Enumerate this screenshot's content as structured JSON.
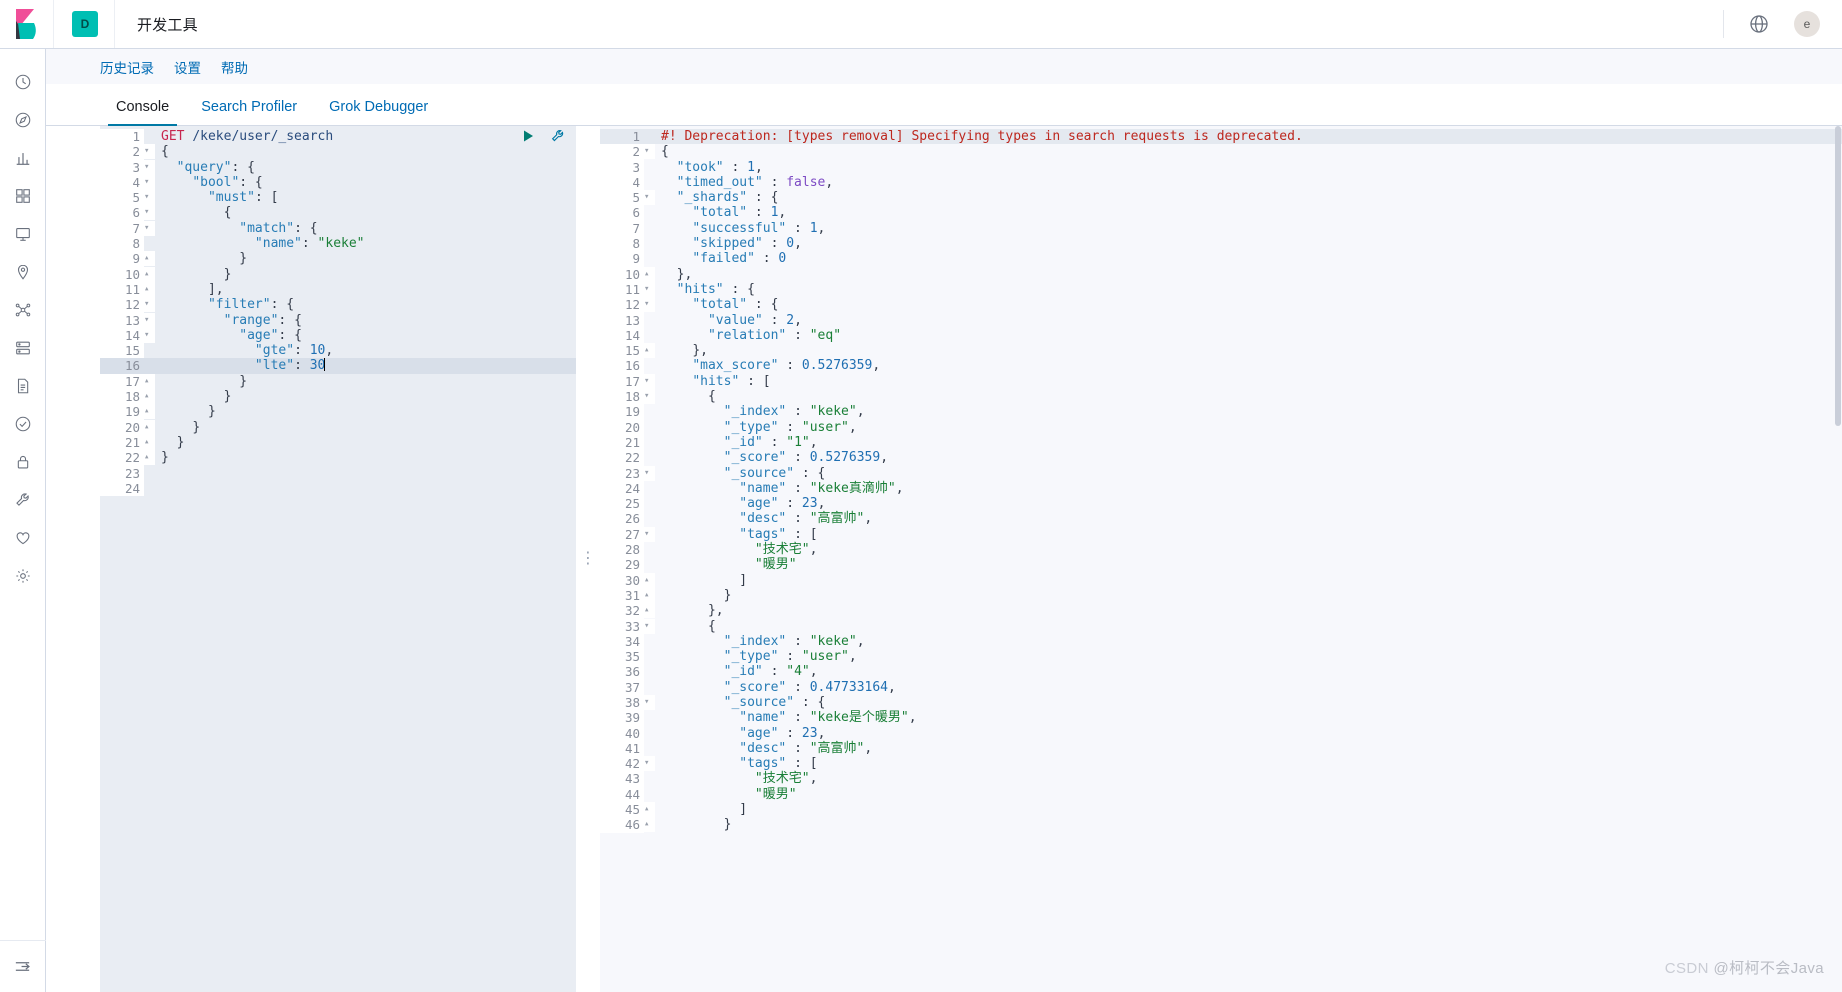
{
  "header": {
    "logo_name": "kibana-logo",
    "space_badge": "D",
    "title": "开发工具",
    "help_icon": "help-circle-icon",
    "avatar_initial": "e"
  },
  "rail": {
    "items": [
      {
        "icon": "recently-viewed-clock-icon",
        "name": "sidebar-item-recent"
      },
      {
        "icon": "compass-discover-icon",
        "name": "sidebar-item-discover"
      },
      {
        "icon": "bar-chart-visualize-icon",
        "name": "sidebar-item-visualize"
      },
      {
        "icon": "dashboard-grid-icon",
        "name": "sidebar-item-dashboard"
      },
      {
        "icon": "canvas-icon",
        "name": "sidebar-item-canvas"
      },
      {
        "icon": "maps-pin-icon",
        "name": "sidebar-item-maps"
      },
      {
        "icon": "machine-learning-icon",
        "name": "sidebar-item-machine-learning"
      },
      {
        "icon": "infrastructure-icon",
        "name": "sidebar-item-infrastructure"
      },
      {
        "icon": "logs-document-icon",
        "name": "sidebar-item-logs"
      },
      {
        "icon": "uptime-check-icon",
        "name": "sidebar-item-uptime"
      },
      {
        "icon": "security-lock-icon",
        "name": "sidebar-item-security"
      },
      {
        "icon": "dev-tools-wrench-icon",
        "name": "sidebar-item-dev-tools"
      },
      {
        "icon": "monitoring-heart-icon",
        "name": "sidebar-item-monitoring"
      },
      {
        "icon": "management-gear-icon",
        "name": "sidebar-item-management"
      }
    ],
    "collapse_icon": "collapse-arrow-icon"
  },
  "subnav": {
    "items": [
      {
        "label": "历史记录",
        "name": "subnav-history"
      },
      {
        "label": "设置",
        "name": "subnav-settings"
      },
      {
        "label": "帮助",
        "name": "subnav-help"
      }
    ]
  },
  "tabs": [
    {
      "label": "Console",
      "active": true,
      "name": "tab-console"
    },
    {
      "label": "Search Profiler",
      "active": false,
      "name": "tab-search-profiler"
    },
    {
      "label": "Grok Debugger",
      "active": false,
      "name": "tab-grok-debugger"
    }
  ],
  "editor_actions": {
    "run_icon": "play-triangle-icon",
    "wrench_icon": "wrench-icon"
  },
  "request_editor": {
    "highlighted_line": 16,
    "caret_line": 16,
    "lines": [
      {
        "n": 1,
        "fold": "",
        "html": "<span class='t-method'>GET</span> <span class='t-url'>/keke/user/_search</span>"
      },
      {
        "n": 2,
        "fold": "▾",
        "html": "<span class='t-punct'>{</span>"
      },
      {
        "n": 3,
        "fold": "▾",
        "html": "  <span class='t-key'>\"query\"</span><span class='t-punct'>: {</span>"
      },
      {
        "n": 4,
        "fold": "▾",
        "html": "    <span class='t-key'>\"bool\"</span><span class='t-punct'>: {</span>"
      },
      {
        "n": 5,
        "fold": "▾",
        "html": "      <span class='t-key'>\"must\"</span><span class='t-punct'>: [</span>"
      },
      {
        "n": 6,
        "fold": "▾",
        "html": "        <span class='t-punct'>{</span>"
      },
      {
        "n": 7,
        "fold": "▾",
        "html": "          <span class='t-key'>\"match\"</span><span class='t-punct'>: {</span>"
      },
      {
        "n": 8,
        "fold": "",
        "html": "            <span class='t-key'>\"name\"</span><span class='t-punct'>: </span><span class='t-str'>\"keke\"</span>"
      },
      {
        "n": 9,
        "fold": "▴",
        "html": "          <span class='t-punct'>}</span>"
      },
      {
        "n": 10,
        "fold": "▴",
        "html": "        <span class='t-punct'>}</span>"
      },
      {
        "n": 11,
        "fold": "▴",
        "html": "      <span class='t-punct'>],</span>"
      },
      {
        "n": 12,
        "fold": "▾",
        "html": "      <span class='t-key'>\"filter\"</span><span class='t-punct'>: {</span>"
      },
      {
        "n": 13,
        "fold": "▾",
        "html": "        <span class='t-key'>\"range\"</span><span class='t-punct'>: {</span>"
      },
      {
        "n": 14,
        "fold": "▾",
        "html": "          <span class='t-key'>\"age\"</span><span class='t-punct'>: {</span>"
      },
      {
        "n": 15,
        "fold": "",
        "html": "            <span class='t-key'>\"gte\"</span><span class='t-punct'>: </span><span class='t-num'>10</span><span class='t-punct'>,</span>"
      },
      {
        "n": 16,
        "fold": "",
        "html": "            <span class='t-key'>\"lte\"</span><span class='t-punct'>: </span><span class='t-num'>30</span><span class='caret'></span>"
      },
      {
        "n": 17,
        "fold": "▴",
        "html": "          <span class='t-punct'>}</span>"
      },
      {
        "n": 18,
        "fold": "▴",
        "html": "        <span class='t-punct'>}</span>"
      },
      {
        "n": 19,
        "fold": "▴",
        "html": "      <span class='t-punct'>}</span>"
      },
      {
        "n": 20,
        "fold": "▴",
        "html": "    <span class='t-punct'>}</span>"
      },
      {
        "n": 21,
        "fold": "▴",
        "html": "  <span class='t-punct'>}</span>"
      },
      {
        "n": 22,
        "fold": "▴",
        "html": "<span class='t-punct'>}</span>"
      },
      {
        "n": 23,
        "fold": "",
        "html": ""
      },
      {
        "n": 24,
        "fold": "",
        "html": ""
      }
    ]
  },
  "response_editor": {
    "highlighted_line": 1,
    "lines": [
      {
        "n": 1,
        "fold": "",
        "html": "<span class='t-warn'>#! Deprecation: [types removal] Specifying types in search requests is deprecated.</span>"
      },
      {
        "n": 2,
        "fold": "▾",
        "html": "<span class='t-punct'>{</span>"
      },
      {
        "n": 3,
        "fold": "",
        "html": "  <span class='t-key'>\"took\"</span><span class='t-punct'> : </span><span class='t-num'>1</span><span class='t-punct'>,</span>"
      },
      {
        "n": 4,
        "fold": "",
        "html": "  <span class='t-key'>\"timed_out\"</span><span class='t-punct'> : </span><span class='t-bool'>false</span><span class='t-punct'>,</span>"
      },
      {
        "n": 5,
        "fold": "▾",
        "html": "  <span class='t-key'>\"_shards\"</span><span class='t-punct'> : {</span>"
      },
      {
        "n": 6,
        "fold": "",
        "html": "    <span class='t-key'>\"total\"</span><span class='t-punct'> : </span><span class='t-num'>1</span><span class='t-punct'>,</span>"
      },
      {
        "n": 7,
        "fold": "",
        "html": "    <span class='t-key'>\"successful\"</span><span class='t-punct'> : </span><span class='t-num'>1</span><span class='t-punct'>,</span>"
      },
      {
        "n": 8,
        "fold": "",
        "html": "    <span class='t-key'>\"skipped\"</span><span class='t-punct'> : </span><span class='t-num'>0</span><span class='t-punct'>,</span>"
      },
      {
        "n": 9,
        "fold": "",
        "html": "    <span class='t-key'>\"failed\"</span><span class='t-punct'> : </span><span class='t-num'>0</span>"
      },
      {
        "n": 10,
        "fold": "▴",
        "html": "  <span class='t-punct'>},</span>"
      },
      {
        "n": 11,
        "fold": "▾",
        "html": "  <span class='t-key'>\"hits\"</span><span class='t-punct'> : {</span>"
      },
      {
        "n": 12,
        "fold": "▾",
        "html": "    <span class='t-key'>\"total\"</span><span class='t-punct'> : {</span>"
      },
      {
        "n": 13,
        "fold": "",
        "html": "      <span class='t-key'>\"value\"</span><span class='t-punct'> : </span><span class='t-num'>2</span><span class='t-punct'>,</span>"
      },
      {
        "n": 14,
        "fold": "",
        "html": "      <span class='t-key'>\"relation\"</span><span class='t-punct'> : </span><span class='t-str'>\"eq\"</span>"
      },
      {
        "n": 15,
        "fold": "▴",
        "html": "    <span class='t-punct'>},</span>"
      },
      {
        "n": 16,
        "fold": "",
        "html": "    <span class='t-key'>\"max_score\"</span><span class='t-punct'> : </span><span class='t-num'>0.5276359</span><span class='t-punct'>,</span>"
      },
      {
        "n": 17,
        "fold": "▾",
        "html": "    <span class='t-key'>\"hits\"</span><span class='t-punct'> : [</span>"
      },
      {
        "n": 18,
        "fold": "▾",
        "html": "      <span class='t-punct'>{</span>"
      },
      {
        "n": 19,
        "fold": "",
        "html": "        <span class='t-key'>\"_index\"</span><span class='t-punct'> : </span><span class='t-str'>\"keke\"</span><span class='t-punct'>,</span>"
      },
      {
        "n": 20,
        "fold": "",
        "html": "        <span class='t-key'>\"_type\"</span><span class='t-punct'> : </span><span class='t-str'>\"user\"</span><span class='t-punct'>,</span>"
      },
      {
        "n": 21,
        "fold": "",
        "html": "        <span class='t-key'>\"_id\"</span><span class='t-punct'> : </span><span class='t-str'>\"1\"</span><span class='t-punct'>,</span>"
      },
      {
        "n": 22,
        "fold": "",
        "html": "        <span class='t-key'>\"_score\"</span><span class='t-punct'> : </span><span class='t-num'>0.5276359</span><span class='t-punct'>,</span>"
      },
      {
        "n": 23,
        "fold": "▾",
        "html": "        <span class='t-key'>\"_source\"</span><span class='t-punct'> : {</span>"
      },
      {
        "n": 24,
        "fold": "",
        "html": "          <span class='t-key'>\"name\"</span><span class='t-punct'> : </span><span class='t-str'>\"keke真滴帅\"</span><span class='t-punct'>,</span>"
      },
      {
        "n": 25,
        "fold": "",
        "html": "          <span class='t-key'>\"age\"</span><span class='t-punct'> : </span><span class='t-num'>23</span><span class='t-punct'>,</span>"
      },
      {
        "n": 26,
        "fold": "",
        "html": "          <span class='t-key'>\"desc\"</span><span class='t-punct'> : </span><span class='t-str'>\"高富帅\"</span><span class='t-punct'>,</span>"
      },
      {
        "n": 27,
        "fold": "▾",
        "html": "          <span class='t-key'>\"tags\"</span><span class='t-punct'> : [</span>"
      },
      {
        "n": 28,
        "fold": "",
        "html": "            <span class='t-str'>\"技术宅\"</span><span class='t-punct'>,</span>"
      },
      {
        "n": 29,
        "fold": "",
        "html": "            <span class='t-str'>\"暖男\"</span>"
      },
      {
        "n": 30,
        "fold": "▴",
        "html": "          <span class='t-punct'>]</span>"
      },
      {
        "n": 31,
        "fold": "▴",
        "html": "        <span class='t-punct'>}</span>"
      },
      {
        "n": 32,
        "fold": "▴",
        "html": "      <span class='t-punct'>},</span>"
      },
      {
        "n": 33,
        "fold": "▾",
        "html": "      <span class='t-punct'>{</span>"
      },
      {
        "n": 34,
        "fold": "",
        "html": "        <span class='t-key'>\"_index\"</span><span class='t-punct'> : </span><span class='t-str'>\"keke\"</span><span class='t-punct'>,</span>"
      },
      {
        "n": 35,
        "fold": "",
        "html": "        <span class='t-key'>\"_type\"</span><span class='t-punct'> : </span><span class='t-str'>\"user\"</span><span class='t-punct'>,</span>"
      },
      {
        "n": 36,
        "fold": "",
        "html": "        <span class='t-key'>\"_id\"</span><span class='t-punct'> : </span><span class='t-str'>\"4\"</span><span class='t-punct'>,</span>"
      },
      {
        "n": 37,
        "fold": "",
        "html": "        <span class='t-key'>\"_score\"</span><span class='t-punct'> : </span><span class='t-num'>0.47733164</span><span class='t-punct'>,</span>"
      },
      {
        "n": 38,
        "fold": "▾",
        "html": "        <span class='t-key'>\"_source\"</span><span class='t-punct'> : {</span>"
      },
      {
        "n": 39,
        "fold": "",
        "html": "          <span class='t-key'>\"name\"</span><span class='t-punct'> : </span><span class='t-str'>\"keke是个暖男\"</span><span class='t-punct'>,</span>"
      },
      {
        "n": 40,
        "fold": "",
        "html": "          <span class='t-key'>\"age\"</span><span class='t-punct'> : </span><span class='t-num'>23</span><span class='t-punct'>,</span>"
      },
      {
        "n": 41,
        "fold": "",
        "html": "          <span class='t-key'>\"desc\"</span><span class='t-punct'> : </span><span class='t-str'>\"高富帅\"</span><span class='t-punct'>,</span>"
      },
      {
        "n": 42,
        "fold": "▾",
        "html": "          <span class='t-key'>\"tags\"</span><span class='t-punct'> : [</span>"
      },
      {
        "n": 43,
        "fold": "",
        "html": "            <span class='t-str'>\"技术宅\"</span><span class='t-punct'>,</span>"
      },
      {
        "n": 44,
        "fold": "",
        "html": "            <span class='t-str'>\"暖男\"</span>"
      },
      {
        "n": 45,
        "fold": "▴",
        "html": "          <span class='t-punct'>]</span>"
      },
      {
        "n": 46,
        "fold": "▴",
        "html": "        <span class='t-punct'>}</span>"
      }
    ]
  },
  "watermark": {
    "brand": "CSDN",
    "author": " @柯柯不会Java"
  }
}
